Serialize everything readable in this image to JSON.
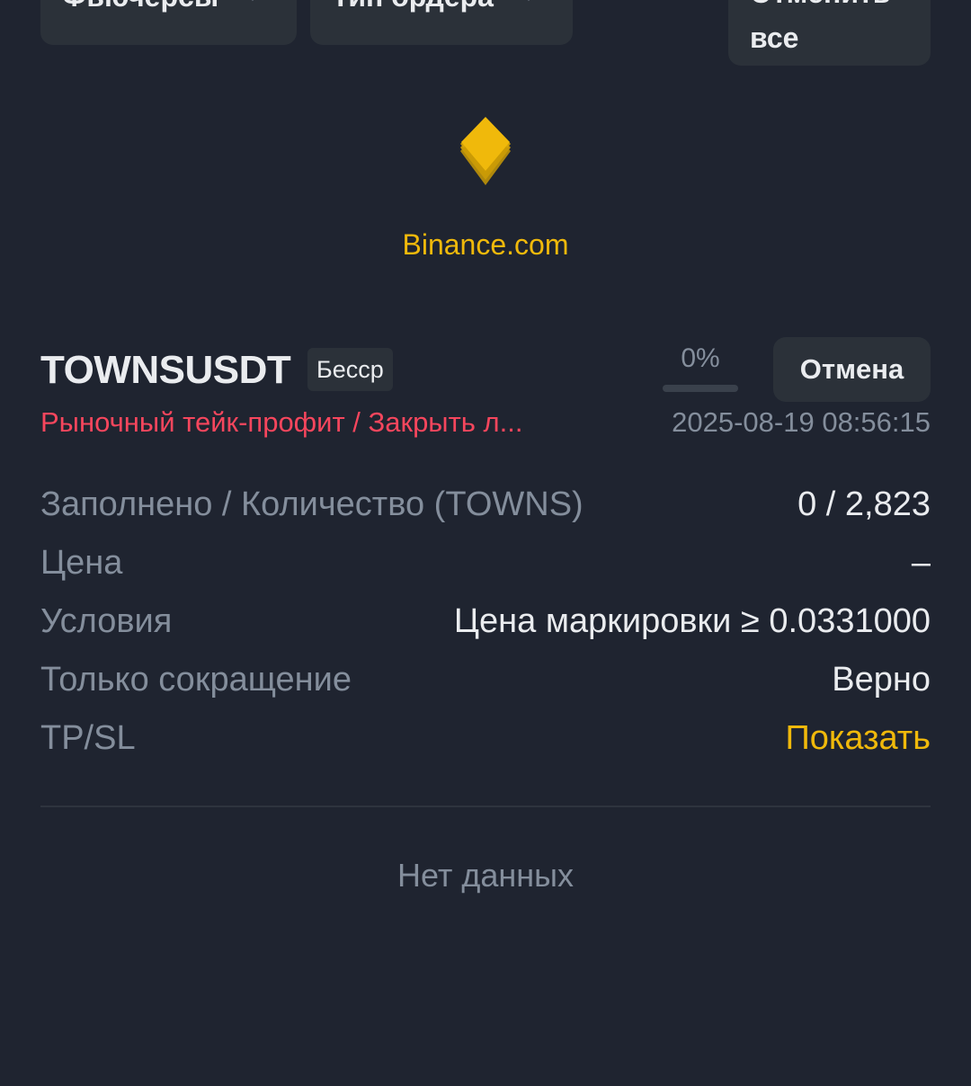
{
  "filters": {
    "futures_label": "Фьючерсы",
    "order_type_label": "Тип ордера",
    "cancel_all_line1": "Отменить",
    "cancel_all_line2": "все"
  },
  "brand": {
    "name": "Binance.com",
    "logo_icon": "binance-logo-icon",
    "accent_color": "#f0b90b"
  },
  "order": {
    "symbol": "TOWNSUSDT",
    "contract_badge": "Бесср",
    "fill_percent_label": "0%",
    "fill_percent": 0,
    "cancel_label": "Отмена",
    "type": "Рыночный тейк-профит / Закрыть л...",
    "time": "2025-08-19 08:56:15",
    "details": [
      {
        "key": "Заполнено / Количество (TOWNS)",
        "value": "0 / 2,823"
      },
      {
        "key": "Цена",
        "value": "–"
      },
      {
        "key": "Условия",
        "value": "Цена маркировки ≥ 0.0331000"
      },
      {
        "key": "Только сокращение",
        "value": "Верно"
      },
      {
        "key": "TP/SL",
        "value": "Показать"
      }
    ]
  },
  "empty_state": "Нет данных",
  "colors": {
    "background": "#1f2430",
    "surface": "#2b3139",
    "sell_red": "#f6465d",
    "muted": "#848e9c"
  }
}
